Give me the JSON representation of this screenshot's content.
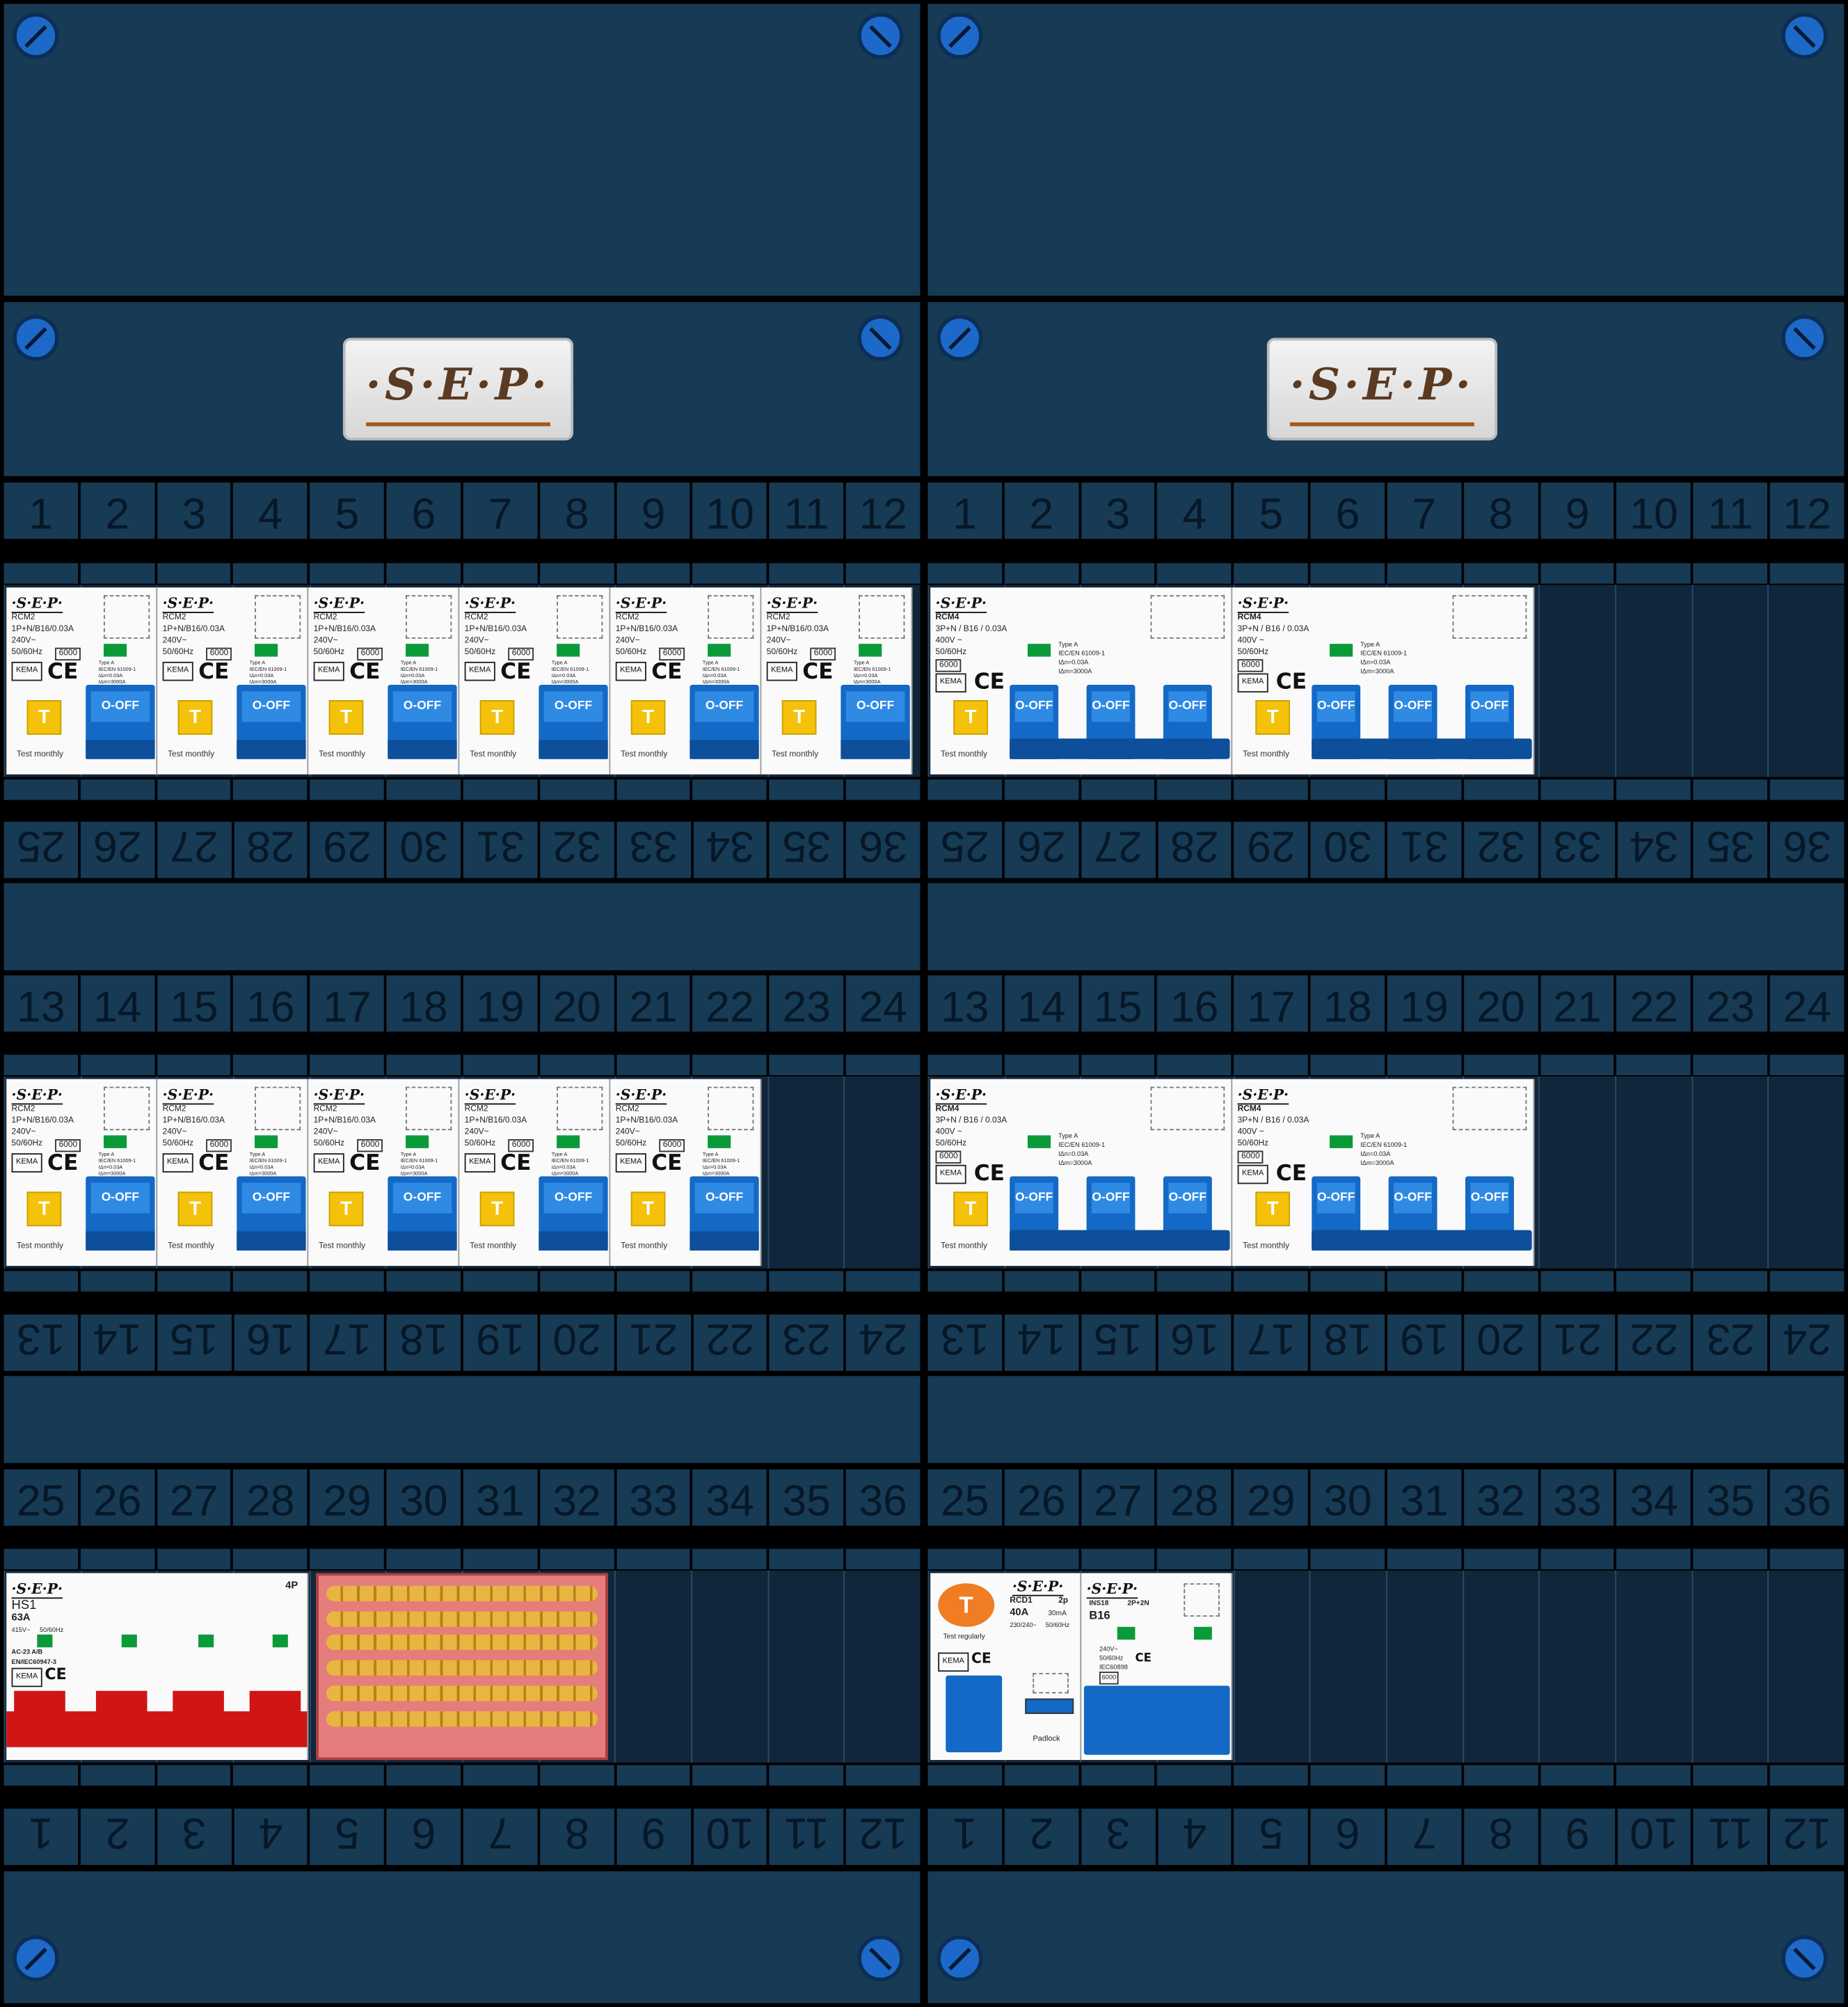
{
  "brand": "·S·E·P·",
  "top_row_numbers": [
    "1",
    "2",
    "3",
    "4",
    "5",
    "6",
    "7",
    "8",
    "9",
    "10",
    "11",
    "12"
  ],
  "row1_bottom_numbers": [
    "36",
    "35",
    "34",
    "33",
    "32",
    "31",
    "30",
    "29",
    "28",
    "27",
    "26",
    "25"
  ],
  "row2_top_numbers": [
    "13",
    "14",
    "15",
    "16",
    "17",
    "18",
    "19",
    "20",
    "21",
    "22",
    "23",
    "24"
  ],
  "row2_bottom_numbers": [
    "24",
    "23",
    "22",
    "21",
    "20",
    "19",
    "18",
    "17",
    "16",
    "15",
    "14",
    "13"
  ],
  "row3_top_numbers": [
    "25",
    "26",
    "27",
    "28",
    "29",
    "30",
    "31",
    "32",
    "33",
    "34",
    "35",
    "36"
  ],
  "row3_bottom_numbers": [
    "12",
    "11",
    "10",
    "9",
    "8",
    "7",
    "6",
    "5",
    "4",
    "3",
    "2",
    "1"
  ],
  "rcm2": {
    "model": "RCM2",
    "spec": "1P+N/B16/0.03A",
    "voltage": "240V~",
    "freq": "50/60Hz",
    "rating": "6000",
    "kema": "KEMA",
    "ce": "CE",
    "type": "Type A",
    "std": "IEC/EN 61009-1",
    "idn": "IΔn=0.03A",
    "idm": "IΔm=3000A",
    "test_btn": "T",
    "toggle": "O-OFF",
    "footer": "Test monthly"
  },
  "rcm4": {
    "model": "RCM4",
    "spec": "3P+N / B16 / 0.03A",
    "voltage": "400V ~",
    "freq": "50/60Hz",
    "rating": "6000",
    "kema": "KEMA",
    "ce": "CE",
    "type": "Type A",
    "std": "IEC/EN 61009-1",
    "idn": "IΔn=0.03A",
    "idm": "IΔm=3000A",
    "test_btn": "T",
    "toggle": "O-OFF",
    "footer": "Test monthly"
  },
  "hs1": {
    "model": "HS1",
    "rating": "63A",
    "voltage": "415V~",
    "freq": "50/60Hz",
    "cat": "AC-23 A/B",
    "std": "EN/IEC60947-3",
    "poles": "4P",
    "kema": "KEMA",
    "ce": "CE"
  },
  "rcd1": {
    "test_btn": "T",
    "test_label": "Test regularly",
    "model": "RCD1",
    "poles": "2p",
    "rating": "40A",
    "sens": "30mA",
    "voltage": "230/240~",
    "freq": "50/60Hz",
    "padlock": "Padlock",
    "kema": "KEMA",
    "ce": "CE"
  },
  "ins18": {
    "model": "INS18",
    "poles": "2P+2N",
    "curve": "B16",
    "voltage": "240V~",
    "freq": "50/60Hz",
    "std": "IEC60898",
    "rating": "6000",
    "ce": "CE"
  }
}
